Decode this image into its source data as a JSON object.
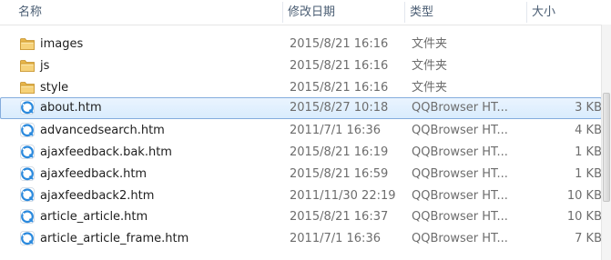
{
  "columns": {
    "name": "名称",
    "date": "修改日期",
    "type": "类型",
    "size": "大小"
  },
  "sort_indicator": "^",
  "files": [
    {
      "name": "images",
      "date": "2015/8/21 16:16",
      "type": "文件夹",
      "size": "",
      "icon": "folder-icon"
    },
    {
      "name": "js",
      "date": "2015/8/21 16:16",
      "type": "文件夹",
      "size": "",
      "icon": "folder-icon"
    },
    {
      "name": "style",
      "date": "2015/8/21 16:16",
      "type": "文件夹",
      "size": "",
      "icon": "folder-icon"
    },
    {
      "name": "about.htm",
      "date": "2015/8/27 10:18",
      "type": "QQBrowser HT...",
      "size": "3 KB",
      "icon": "qqbrowser-htm-icon",
      "selected": true
    },
    {
      "name": "advancedsearch.htm",
      "date": "2011/7/1 16:36",
      "type": "QQBrowser HT...",
      "size": "4 KB",
      "icon": "qqbrowser-htm-icon"
    },
    {
      "name": "ajaxfeedback.bak.htm",
      "date": "2015/8/21 16:19",
      "type": "QQBrowser HT...",
      "size": "1 KB",
      "icon": "qqbrowser-htm-icon"
    },
    {
      "name": "ajaxfeedback.htm",
      "date": "2015/8/21 16:59",
      "type": "QQBrowser HT...",
      "size": "1 KB",
      "icon": "qqbrowser-htm-icon"
    },
    {
      "name": "ajaxfeedback2.htm",
      "date": "2011/11/30 22:19",
      "type": "QQBrowser HT...",
      "size": "10 KB",
      "icon": "qqbrowser-htm-icon"
    },
    {
      "name": "article_article.htm",
      "date": "2015/8/21 16:37",
      "type": "QQBrowser HT...",
      "size": "10 KB",
      "icon": "qqbrowser-htm-icon"
    },
    {
      "name": "article_article_frame.htm",
      "date": "2011/7/1 16:36",
      "type": "QQBrowser HT...",
      "size": "7 KB",
      "icon": "qqbrowser-htm-icon"
    }
  ]
}
